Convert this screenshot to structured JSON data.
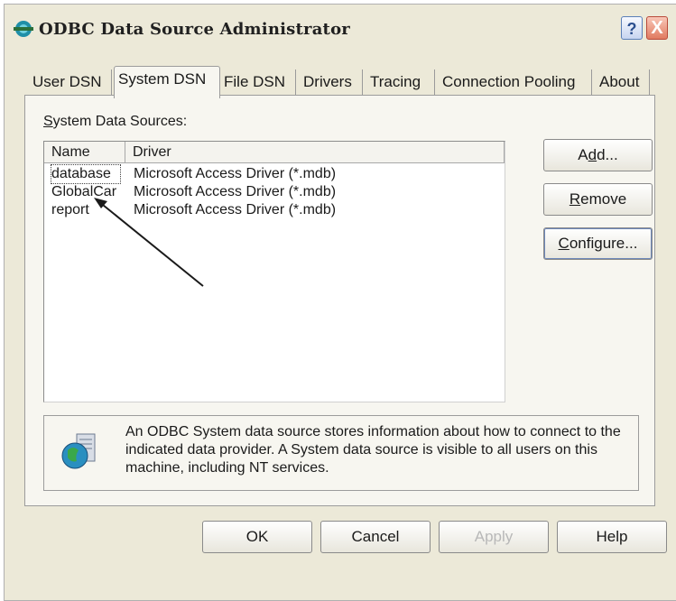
{
  "window": {
    "title": "ODBC Data Source Administrator",
    "help_label": "?",
    "close_label": "X"
  },
  "tabs": [
    {
      "label": "User DSN",
      "active": false
    },
    {
      "label": "System DSN",
      "active": true
    },
    {
      "label": "File DSN",
      "active": false
    },
    {
      "label": "Drivers",
      "active": false
    },
    {
      "label": "Tracing",
      "active": false
    },
    {
      "label": "Connection Pooling",
      "active": false
    },
    {
      "label": "About",
      "active": false
    }
  ],
  "panel": {
    "section_label_accel": "S",
    "section_label_rest": "ystem Data Sources:",
    "columns": {
      "name": "Name",
      "driver": "Driver"
    },
    "rows": [
      {
        "name": "database",
        "driver": "Microsoft Access Driver (*.mdb)"
      },
      {
        "name": "GlobalCar",
        "driver": "Microsoft Access Driver (*.mdb)"
      },
      {
        "name": "report",
        "driver": "Microsoft Access Driver (*.mdb)"
      }
    ],
    "buttons": {
      "add_pre": "A",
      "add_accel": "d",
      "add_post": "d...",
      "remove_accel": "R",
      "remove_post": "emove",
      "configure_accel": "C",
      "configure_post": "onfigure..."
    },
    "info_text": "An ODBC System data source stores information about how to connect to the indicated data provider.  A System data source is visible to all users on this machine, including NT services."
  },
  "footer": {
    "ok": "OK",
    "cancel": "Cancel",
    "apply": "Apply",
    "help": "Help"
  },
  "colors": {
    "window_bg": "#ece9d8",
    "panel_bg": "#f7f6f0",
    "annotation_arrow": "#1a1a1a"
  },
  "icons": [
    "odbc-app-icon",
    "help-icon",
    "close-icon",
    "globe-database-icon"
  ]
}
